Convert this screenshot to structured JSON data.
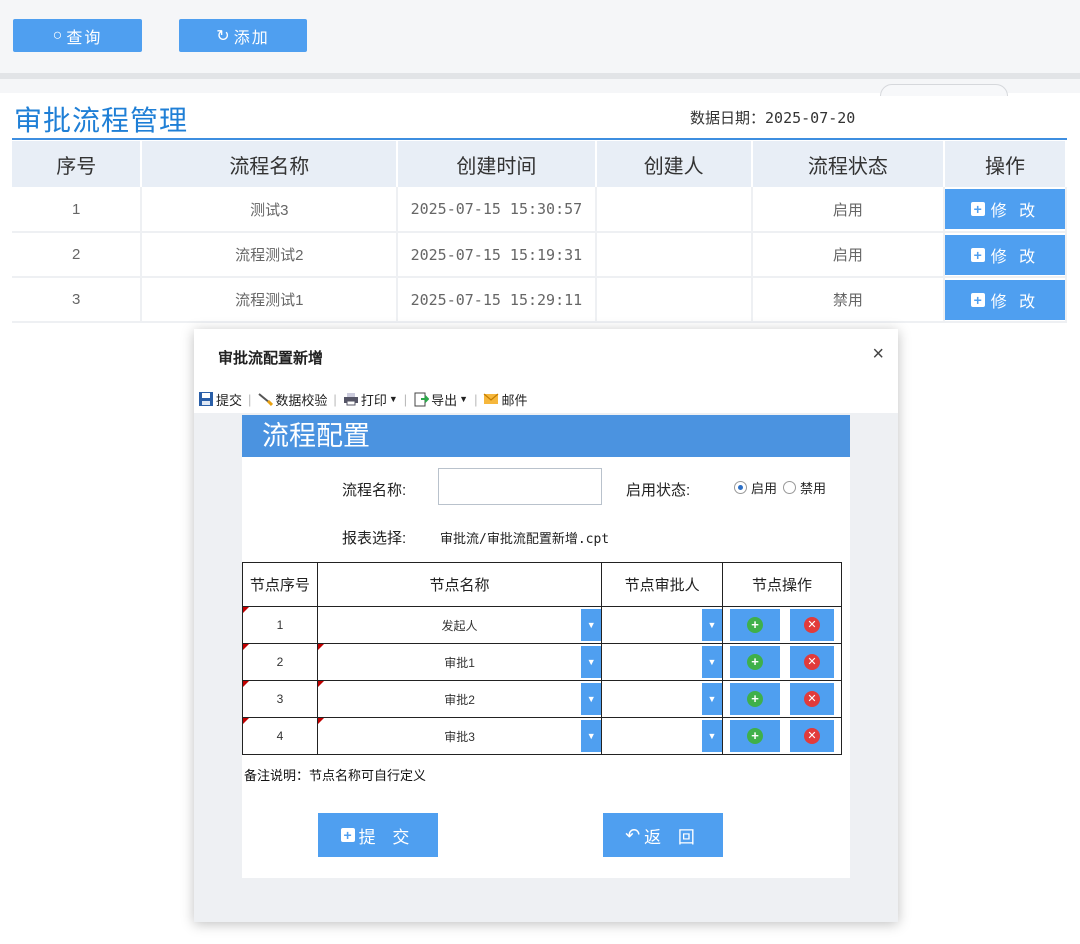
{
  "toolbar": {
    "query_label": "查询",
    "add_label": "添加"
  },
  "page": {
    "title": "审批流程管理",
    "date_label": "数据日期：",
    "date_value": "2025-07-20"
  },
  "table": {
    "headers": [
      "序号",
      "流程名称",
      "创建时间",
      "创建人",
      "流程状态",
      "操作"
    ],
    "rows": [
      {
        "no": "1",
        "name": "测试3",
        "time": "2025-07-15 15:30:57",
        "creator": "",
        "status": "启用",
        "action": "修 改"
      },
      {
        "no": "2",
        "name": "流程测试2",
        "time": "2025-07-15 15:19:31",
        "creator": "",
        "status": "启用",
        "action": "修 改"
      },
      {
        "no": "3",
        "name": "流程测试1",
        "time": "2025-07-15 15:29:11",
        "creator": "",
        "status": "禁用",
        "action": "修 改"
      }
    ]
  },
  "dialog": {
    "title": "审批流配置新增",
    "close": "×",
    "tools": {
      "submit": "提交",
      "validate": "数据校验",
      "print": "打印",
      "export": "导出",
      "mail": "邮件"
    },
    "report": {
      "header": "流程配置",
      "name_label": "流程名称:",
      "name_value": "",
      "status_label": "启用状态:",
      "status_on": "启用",
      "status_off": "禁用",
      "status_selected": "启用",
      "report_label": "报表选择:",
      "report_value": "审批流/审批流配置新增.cpt",
      "node_headers": [
        "节点序号",
        "节点名称",
        "节点审批人",
        "节点操作"
      ],
      "nodes": [
        {
          "no": "1",
          "name": "发起人",
          "approver": ""
        },
        {
          "no": "2",
          "name": "审批1",
          "approver": ""
        },
        {
          "no": "3",
          "name": "审批2",
          "approver": ""
        },
        {
          "no": "4",
          "name": "审批3",
          "approver": ""
        }
      ],
      "note": "备注说明：节点名称可自行定义",
      "submit_label": "提 交",
      "back_label": "返 回"
    }
  }
}
